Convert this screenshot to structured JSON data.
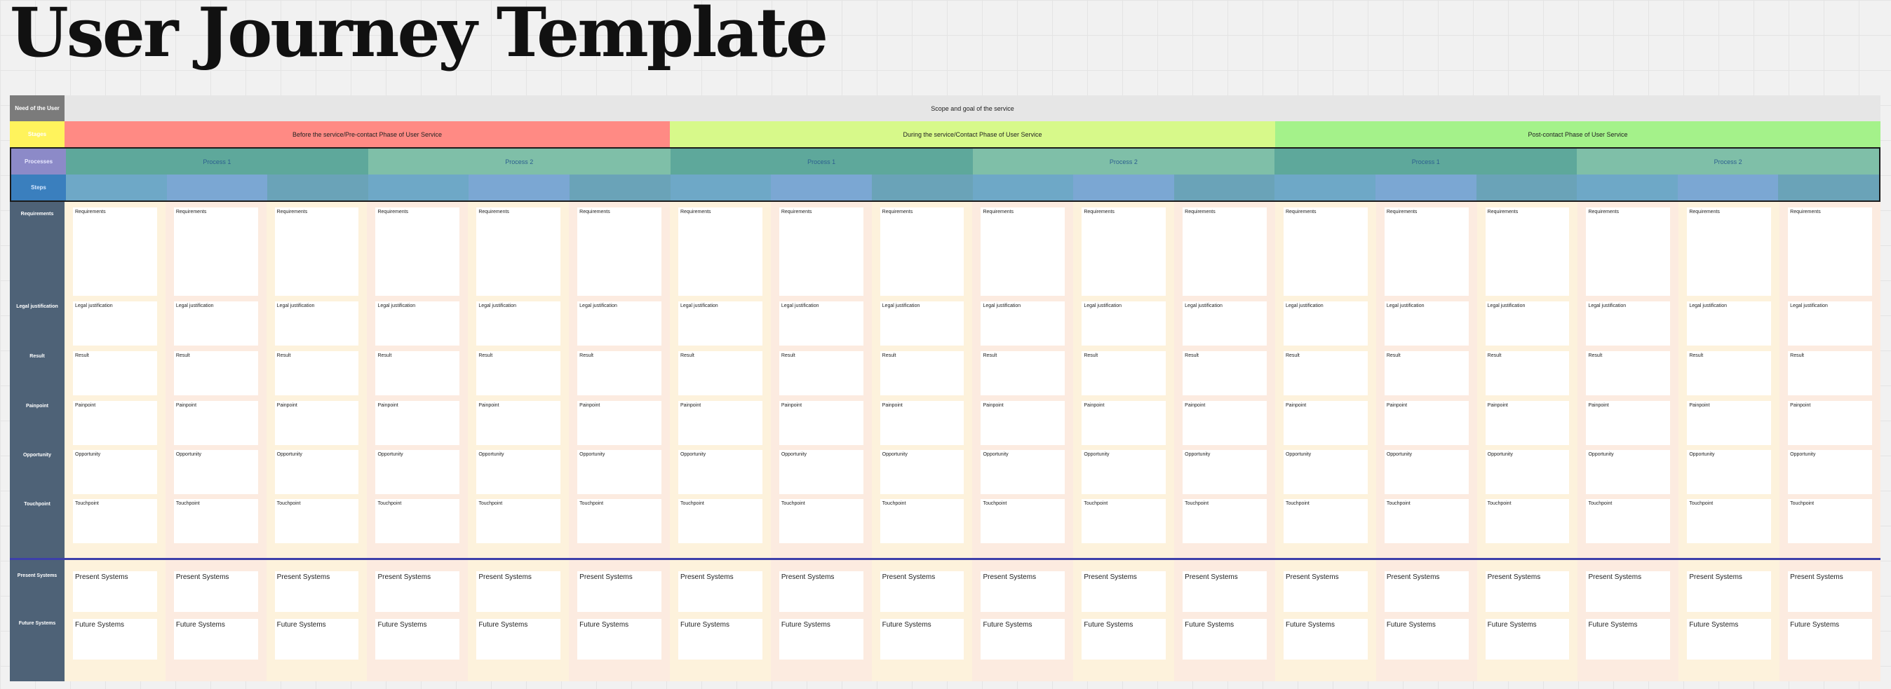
{
  "title": "User Journey Template",
  "need": {
    "label": "Need of the User",
    "text": "Scope and goal of the service"
  },
  "stage": {
    "label": "Stages",
    "items": [
      {
        "text": "Before the service/Pre-contact Phase of User Service",
        "color": "#ff8a84"
      },
      {
        "text": "During the service/Contact Phase of User Service",
        "color": "#d7f98a"
      },
      {
        "text": "Post-contact Phase of User Service",
        "color": "#a4f28a"
      }
    ]
  },
  "processes": {
    "label": "Processes",
    "items": [
      "Process 1",
      "Process 2",
      "Process 1",
      "Process 2",
      "Process 1",
      "Process 2"
    ],
    "colors": [
      "#5ea89b",
      "#7fbfa8"
    ]
  },
  "steps": {
    "label": "Steps",
    "colors": [
      "#6ea8c7",
      "#7ba7d3",
      "#6aa3b8"
    ]
  },
  "rows": [
    {
      "label": "Requirements",
      "card": "Requirements"
    },
    {
      "label": "Legal justification",
      "card": "Legal justification"
    },
    {
      "label": "Result",
      "card": "Result"
    },
    {
      "label": "Painpoint",
      "card": "Painpoint"
    },
    {
      "label": "Opportunity",
      "card": "Opportunity"
    },
    {
      "label": "Touchpoint",
      "card": "Touchpoint"
    },
    {
      "label": "Present Systems",
      "card": "Present Systems"
    },
    {
      "label": "Future Systems",
      "card": "Future Systems"
    }
  ]
}
